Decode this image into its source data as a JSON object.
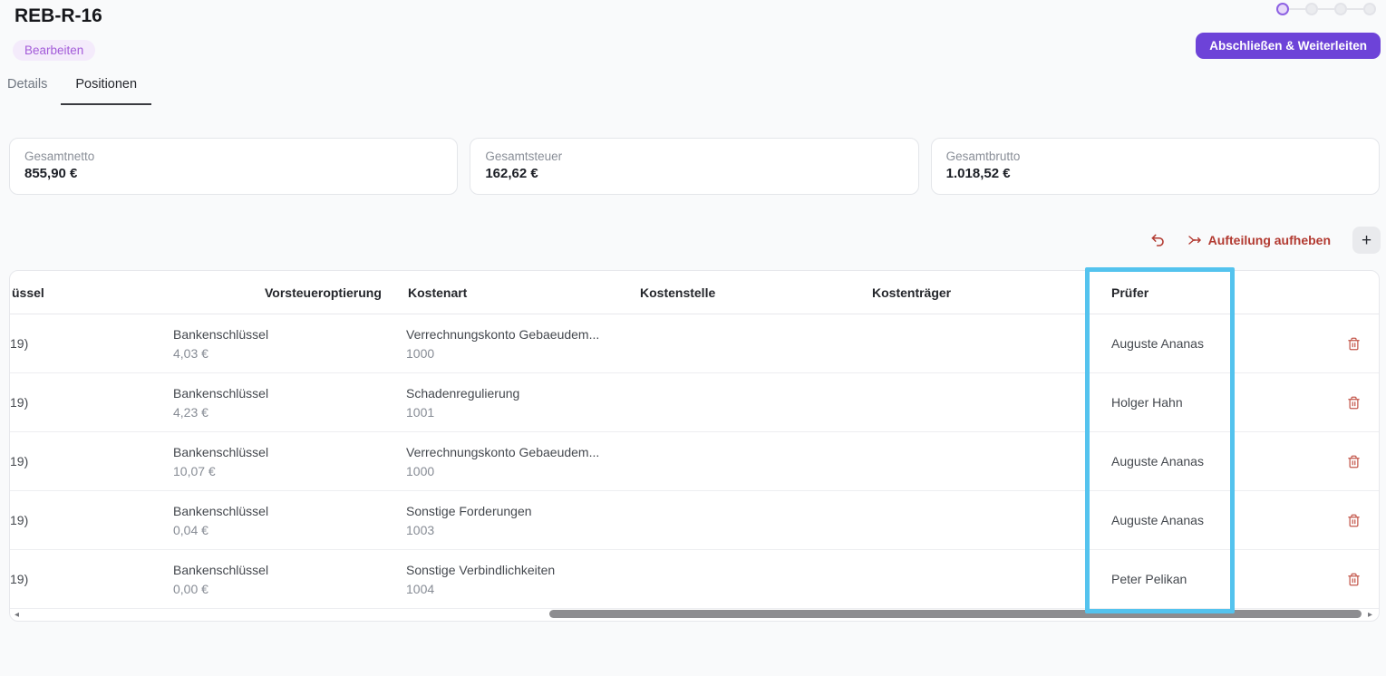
{
  "header": {
    "title": "REB-R-16",
    "status_badge": "Bearbeiten",
    "primary_action": "Abschließen & Weiterleiten"
  },
  "stepper": {
    "total_steps": 4,
    "active_step": 1
  },
  "tabs": [
    {
      "label": "Details",
      "active": false
    },
    {
      "label": "Positionen",
      "active": true
    }
  ],
  "summary_cards": [
    {
      "label": "Gesamtnetto",
      "value": "855,90 €"
    },
    {
      "label": "Gesamtsteuer",
      "value": "162,62 €"
    },
    {
      "label": "Gesamtbrutto",
      "value": "1.018,52 €"
    }
  ],
  "toolbar": {
    "undo_icon": "undo-arrow-icon",
    "split_action_label": "Aufteilung aufheben",
    "add_row_label": "+"
  },
  "table": {
    "columns": [
      "üssel",
      "Vorsteueroptierung",
      "Kostenart",
      "Kostenstelle",
      "Kostenträger",
      "Prüfer"
    ],
    "rows": [
      {
        "tax_key": "19)",
        "vst_label": "Bankenschlüssel",
        "vst_amount": "4,03 €",
        "kostenart": "Verrechnungskonto Gebaeudem...",
        "kostenart_nr": "1000",
        "kostenstelle": "",
        "kostentraeger": "",
        "pruefer": "Auguste Ananas"
      },
      {
        "tax_key": "19)",
        "vst_label": "Bankenschlüssel",
        "vst_amount": "4,23 €",
        "kostenart": "Schadenregulierung",
        "kostenart_nr": "1001",
        "kostenstelle": "",
        "kostentraeger": "",
        "pruefer": "Holger Hahn"
      },
      {
        "tax_key": "19)",
        "vst_label": "Bankenschlüssel",
        "vst_amount": "10,07 €",
        "kostenart": "Verrechnungskonto Gebaeudem...",
        "kostenart_nr": "1000",
        "kostenstelle": "",
        "kostentraeger": "",
        "pruefer": "Auguste Ananas"
      },
      {
        "tax_key": "19)",
        "vst_label": "Bankenschlüssel",
        "vst_amount": "0,04 €",
        "kostenart": "Sonstige Forderungen",
        "kostenart_nr": "1003",
        "kostenstelle": "",
        "kostentraeger": "",
        "pruefer": "Auguste Ananas"
      },
      {
        "tax_key": "19)",
        "vst_label": "Bankenschlüssel",
        "vst_amount": "0,00 €",
        "kostenart": "Sonstige Verbindlichkeiten",
        "kostenart_nr": "1004",
        "kostenstelle": "",
        "kostentraeger": "",
        "pruefer": "Peter Pelikan"
      }
    ],
    "highlighted_column": "Prüfer"
  },
  "scrollbar": {
    "left_arrow": "◂",
    "right_arrow": "▸"
  },
  "colors": {
    "accent_purple": "#6d43d8",
    "badge_purple": "#a35bd9",
    "danger_red": "#b23a31",
    "trash_red": "#c4584c",
    "highlight_blue": "#54c3ee"
  }
}
